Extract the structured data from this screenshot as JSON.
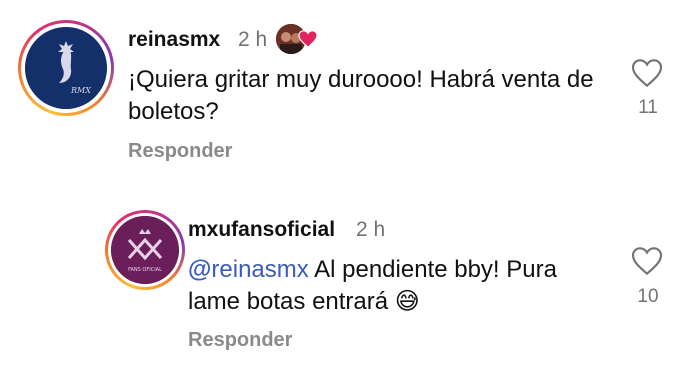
{
  "comments": [
    {
      "username": "reinasmx",
      "time": "2 h",
      "text": "¡Quiera gritar muy duroooo! Habrá venta de boletos?",
      "reply_label": "Responder",
      "likes": "11",
      "avatar_text": "RMX"
    },
    {
      "username": "mxufansoficial",
      "time": "2 h",
      "mention": "reinasmx",
      "text": " Al pendiente bby! Pura lame botas entrará 😅",
      "reply_label": "Responder",
      "likes": "10",
      "avatar_text": "FANS OFICIAL"
    }
  ],
  "colors": {
    "mention": "#3b5bbf",
    "meta": "#737373",
    "heart_red": "#e0245e"
  },
  "icons": {
    "like": "heart-outline-icon",
    "author_reaction": "heart-filled-icon"
  }
}
